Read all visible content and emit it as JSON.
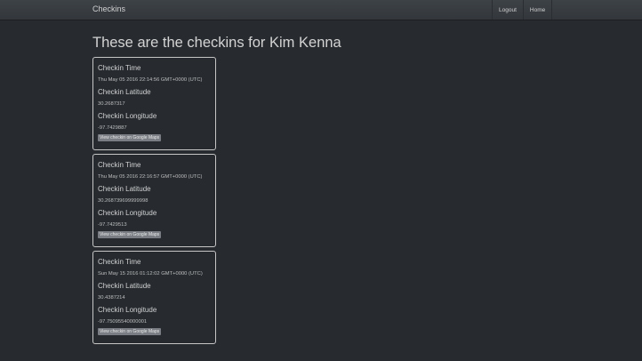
{
  "navbar": {
    "brand": "Checkins",
    "links": [
      "Logout",
      "Home"
    ]
  },
  "page": {
    "title": "These are the checkins for Kim Kenna"
  },
  "field_labels": {
    "time": "Checkin Time",
    "latitude": "Checkin Latitude",
    "longitude": "Checkin Longitude",
    "maps_button": "View checkin on Google Maps"
  },
  "checkins": [
    {
      "time": "Thu May 05 2016 22:14:56 GMT+0000 (UTC)",
      "latitude": "30.2687317",
      "longitude": "-97.7429887"
    },
    {
      "time": "Thu May 05 2016 22:16:57 GMT+0000 (UTC)",
      "latitude": "30.268739699999998",
      "longitude": "-97.7429513"
    },
    {
      "time": "Sun May 15 2016 01:12:02 GMT+0000 (UTC)",
      "latitude": "30.4387214",
      "longitude": "-97.75095540000001"
    }
  ]
}
